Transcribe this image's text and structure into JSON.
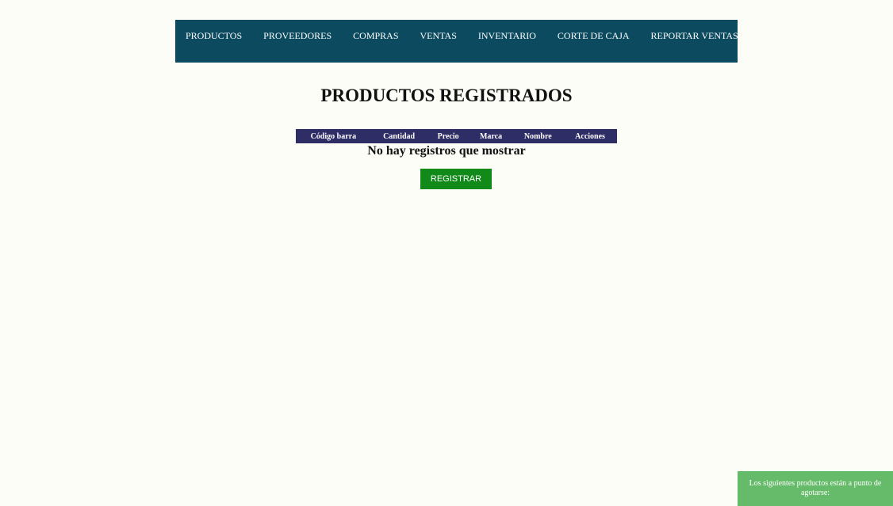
{
  "nav": {
    "items": [
      {
        "label": "PRODUCTOS"
      },
      {
        "label": "PROVEEDORES"
      },
      {
        "label": "COMPRAS"
      },
      {
        "label": "VENTAS"
      },
      {
        "label": "INVENTARIO"
      },
      {
        "label": "CORTE DE CAJA"
      },
      {
        "label": "REPORTAR VENTAS"
      }
    ]
  },
  "main": {
    "title": "PRODUCTOS REGISTRADOS",
    "table": {
      "columns": [
        "Código barra",
        "Cantidad",
        "Precio",
        "Marca",
        "Nombre",
        "Acciones"
      ],
      "rows": []
    },
    "empty_message": "No hay registros que mostrar",
    "register_label": "REGISTRAR"
  },
  "toast": {
    "message": "Los siguientes productos están a punto de agotarse:"
  },
  "colors": {
    "navbar": "#0b4a5f",
    "table_header": "#2f2d66",
    "register_button": "#118a1a",
    "toast": "#66bb6a",
    "background": "#fdfdf8"
  }
}
